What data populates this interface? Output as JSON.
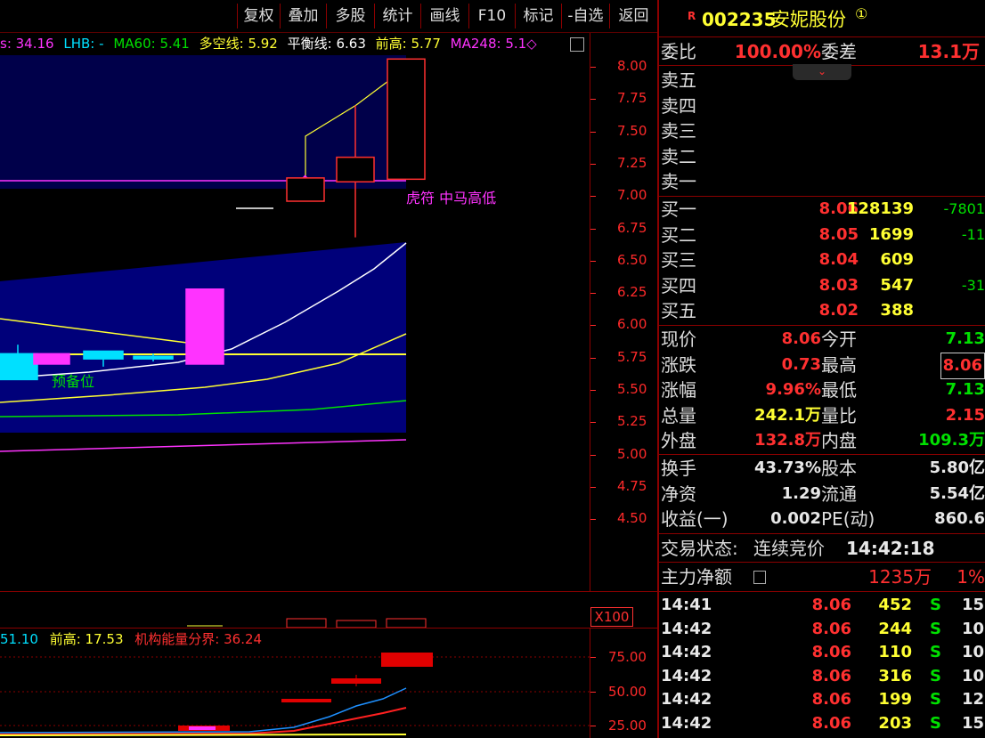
{
  "toolbar": {
    "buttons": [
      "复权",
      "叠加",
      "多股",
      "统计",
      "画线",
      "F10",
      "标记",
      "-自选",
      "返回"
    ]
  },
  "indicator_line": {
    "items": [
      {
        "text": "s: 34.16",
        "color": "#ff33ff"
      },
      {
        "text": "LHB: -",
        "color": "#00e0ff"
      },
      {
        "text": "MA60: 5.41",
        "color": "#00e000"
      },
      {
        "text": "多空线: 5.92",
        "color": "#ffff33"
      },
      {
        "text": "平衡线: 6.63",
        "color": "#ffffff"
      },
      {
        "text": "前高: 5.77",
        "color": "#ffff33"
      },
      {
        "text": "MA248: 5.1◇",
        "color": "#ff33ff"
      }
    ]
  },
  "main_chart": {
    "annotation_tiger": "虎符 中马高低",
    "annotation_prep": "预备位",
    "price_axis": [
      "8.00",
      "7.75",
      "7.50",
      "7.25",
      "7.00",
      "6.75",
      "6.50",
      "6.25",
      "6.00",
      "5.75",
      "5.50",
      "5.25",
      "5.00",
      "4.75",
      "4.50"
    ],
    "candles": [
      {
        "open": 5.78,
        "high": 5.85,
        "low": 5.66,
        "close": 5.58,
        "color": "#00e0ff"
      },
      {
        "open": 5.7,
        "high": 5.78,
        "low": 5.7,
        "close": 5.78,
        "color": "#ff33ff"
      },
      {
        "open": 5.8,
        "high": 5.8,
        "low": 5.68,
        "close": 5.74,
        "color": "#00e0ff"
      },
      {
        "open": 5.76,
        "high": 5.78,
        "low": 5.72,
        "close": 5.74,
        "color": "#00e0ff"
      },
      {
        "open": 5.7,
        "high": 6.28,
        "low": 5.7,
        "close": 6.28,
        "color": "#ff33ff"
      },
      {
        "open": 6.96,
        "high": 7.14,
        "low": 6.96,
        "close": 7.14,
        "color": "#ff3030"
      },
      {
        "open": 7.11,
        "high": 7.7,
        "low": 6.68,
        "close": 7.3,
        "color": "#ff3030"
      },
      {
        "open": 7.13,
        "high": 8.06,
        "low": 7.13,
        "close": 8.06,
        "color": "#ff3030"
      }
    ]
  },
  "sub_chart": {
    "multiplier": "X100",
    "indicators": [
      {
        "text": "51.10",
        "color": "#00e0ff"
      },
      {
        "text": "前高: 17.53",
        "color": "#ffff33"
      },
      {
        "text": "机构能量分界: 36.24",
        "color": "#ff3030"
      }
    ],
    "axis": [
      "75.00",
      "50.00",
      "25.00"
    ]
  },
  "quote": {
    "marker": "R",
    "code": "002235",
    "name": "安妮股份",
    "badge": "①",
    "weibi_label": "委比",
    "weibi_value": "100.00%",
    "weicha_label": "委差",
    "weicha_value": "13.1万",
    "sell": [
      {
        "label": "卖五",
        "price": "",
        "vol": "",
        "chg": ""
      },
      {
        "label": "卖四",
        "price": "",
        "vol": "",
        "chg": ""
      },
      {
        "label": "卖三",
        "price": "",
        "vol": "",
        "chg": ""
      },
      {
        "label": "卖二",
        "price": "",
        "vol": "",
        "chg": ""
      },
      {
        "label": "卖一",
        "price": "",
        "vol": "",
        "chg": ""
      }
    ],
    "buy": [
      {
        "label": "买一",
        "price": "8.06",
        "vol": "128139",
        "chg": "-7801"
      },
      {
        "label": "买二",
        "price": "8.05",
        "vol": "1699",
        "chg": "-11"
      },
      {
        "label": "买三",
        "price": "8.04",
        "vol": "609",
        "chg": ""
      },
      {
        "label": "买四",
        "price": "8.03",
        "vol": "547",
        "chg": "-31"
      },
      {
        "label": "买五",
        "price": "8.02",
        "vol": "388",
        "chg": ""
      }
    ],
    "stats": [
      {
        "l1": "现价",
        "v1": "8.06",
        "c1": "#ff3030",
        "l2": "今开",
        "v2": "7.13",
        "c2": "#00e000"
      },
      {
        "l1": "涨跌",
        "v1": "0.73",
        "c1": "#ff3030",
        "l2": "最高",
        "v2": "8.06",
        "c2": "#ff3030"
      },
      {
        "l1": "涨幅",
        "v1": "9.96%",
        "c1": "#ff3030",
        "l2": "最低",
        "v2": "7.13",
        "c2": "#00e000"
      },
      {
        "l1": "总量",
        "v1": "242.1万",
        "c1": "#ffff33",
        "l2": "量比",
        "v2": "2.15",
        "c2": "#ff3030"
      },
      {
        "l1": "外盘",
        "v1": "132.8万",
        "c1": "#ff3030",
        "l2": "内盘",
        "v2": "109.3万",
        "c2": "#00e000"
      }
    ],
    "stats2": [
      {
        "l1": "换手",
        "v1": "43.73%",
        "l2": "股本",
        "v2": "5.80亿"
      },
      {
        "l1": "净资",
        "v1": "1.29",
        "l2": "流通",
        "v2": "5.54亿"
      },
      {
        "l1": "收益(一)",
        "v1": "0.002",
        "l2": "PE(动)",
        "v2": "860.6"
      }
    ],
    "trade_status_label": "交易状态:",
    "trade_status_value": "连续竞价",
    "trade_status_time": "14:42:18",
    "main_force_label": "主力净额",
    "main_force_value": "1235万",
    "main_force_pct": "1%",
    "ticks": [
      {
        "time": "14:41",
        "price": "8.06",
        "vol": "452",
        "side": "S",
        "num": "15"
      },
      {
        "time": "14:42",
        "price": "8.06",
        "vol": "244",
        "side": "S",
        "num": "10"
      },
      {
        "time": "14:42",
        "price": "8.06",
        "vol": "110",
        "side": "S",
        "num": "10"
      },
      {
        "time": "14:42",
        "price": "8.06",
        "vol": "316",
        "side": "S",
        "num": "10"
      },
      {
        "time": "14:42",
        "price": "8.06",
        "vol": "199",
        "side": "S",
        "num": "12"
      },
      {
        "time": "14:42",
        "price": "8.06",
        "vol": "203",
        "side": "S",
        "num": "15"
      }
    ]
  }
}
